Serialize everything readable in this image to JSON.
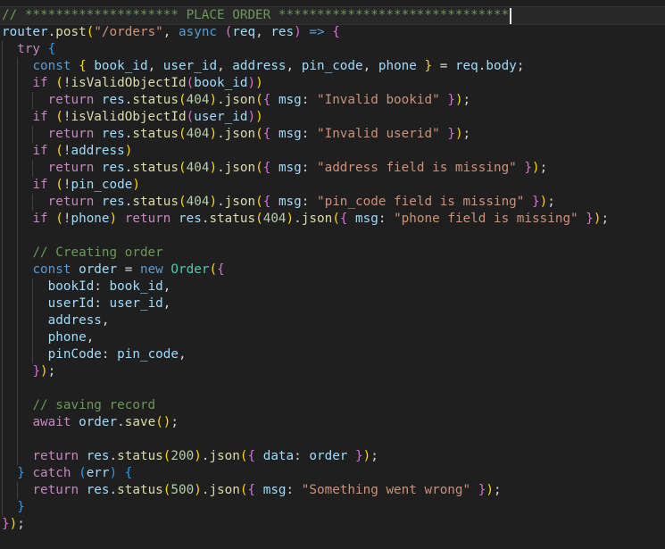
{
  "editor": {
    "language": "javascript",
    "colors": {
      "background": "#1f1f1f",
      "keyword": "#569cd6",
      "control": "#c586c0",
      "variable": "#9cdcfe",
      "function": "#dcdcaa",
      "string": "#ce9178",
      "number": "#b5cea8",
      "class": "#4ec9b0",
      "comment": "#6a9955",
      "bracket_1": "#ffd700",
      "bracket_2": "#da70d6",
      "bracket_3": "#179fff"
    },
    "lines": [
      [
        [
          "cmt",
          "// ******************** PLACE ORDER ******************************"
        ]
      ],
      [
        [
          "var",
          "router"
        ],
        [
          "pun",
          "."
        ],
        [
          "fn",
          "post"
        ],
        [
          "b1",
          "("
        ],
        [
          "str",
          "\"/orders\""
        ],
        [
          "pun",
          ", "
        ],
        [
          "kw",
          "async"
        ],
        [
          "pun",
          " "
        ],
        [
          "b2",
          "("
        ],
        [
          "var",
          "req"
        ],
        [
          "pun",
          ", "
        ],
        [
          "var",
          "res"
        ],
        [
          "b2",
          ")"
        ],
        [
          "pun",
          " "
        ],
        [
          "kw",
          "=>"
        ],
        [
          "pun",
          " "
        ],
        [
          "b2",
          "{"
        ]
      ],
      [
        [
          "pun",
          "  "
        ],
        [
          "ctl",
          "try"
        ],
        [
          "pun",
          " "
        ],
        [
          "b3",
          "{"
        ]
      ],
      [
        [
          "pun",
          "    "
        ],
        [
          "kw",
          "const"
        ],
        [
          "pun",
          " "
        ],
        [
          "b1",
          "{"
        ],
        [
          "pun",
          " "
        ],
        [
          "var",
          "book_id"
        ],
        [
          "pun",
          ", "
        ],
        [
          "var",
          "user_id"
        ],
        [
          "pun",
          ", "
        ],
        [
          "var",
          "address"
        ],
        [
          "pun",
          ", "
        ],
        [
          "var",
          "pin_code"
        ],
        [
          "pun",
          ", "
        ],
        [
          "var",
          "phone"
        ],
        [
          "pun",
          " "
        ],
        [
          "b1",
          "}"
        ],
        [
          "pun",
          " = "
        ],
        [
          "var",
          "req"
        ],
        [
          "pun",
          "."
        ],
        [
          "var",
          "body"
        ],
        [
          "pun",
          ";"
        ]
      ],
      [
        [
          "pun",
          "    "
        ],
        [
          "ctl",
          "if"
        ],
        [
          "pun",
          " "
        ],
        [
          "b1",
          "("
        ],
        [
          "pun",
          "!"
        ],
        [
          "fn",
          "isValidObjectId"
        ],
        [
          "b2",
          "("
        ],
        [
          "var",
          "book_id"
        ],
        [
          "b2",
          ")"
        ],
        [
          "b1",
          ")"
        ]
      ],
      [
        [
          "pun",
          "      "
        ],
        [
          "ctl",
          "return"
        ],
        [
          "pun",
          " "
        ],
        [
          "var",
          "res"
        ],
        [
          "pun",
          "."
        ],
        [
          "fn",
          "status"
        ],
        [
          "b1",
          "("
        ],
        [
          "num",
          "404"
        ],
        [
          "b1",
          ")"
        ],
        [
          "pun",
          "."
        ],
        [
          "fn",
          "json"
        ],
        [
          "b1",
          "("
        ],
        [
          "b2",
          "{"
        ],
        [
          "pun",
          " "
        ],
        [
          "var",
          "msg"
        ],
        [
          "pun",
          ": "
        ],
        [
          "str",
          "\"Invalid bookid\""
        ],
        [
          "pun",
          " "
        ],
        [
          "b2",
          "}"
        ],
        [
          "b1",
          ")"
        ],
        [
          "pun",
          ";"
        ]
      ],
      [
        [
          "pun",
          "    "
        ],
        [
          "ctl",
          "if"
        ],
        [
          "pun",
          " "
        ],
        [
          "b1",
          "("
        ],
        [
          "pun",
          "!"
        ],
        [
          "fn",
          "isValidObjectId"
        ],
        [
          "b2",
          "("
        ],
        [
          "var",
          "user_id"
        ],
        [
          "b2",
          ")"
        ],
        [
          "b1",
          ")"
        ]
      ],
      [
        [
          "pun",
          "      "
        ],
        [
          "ctl",
          "return"
        ],
        [
          "pun",
          " "
        ],
        [
          "var",
          "res"
        ],
        [
          "pun",
          "."
        ],
        [
          "fn",
          "status"
        ],
        [
          "b1",
          "("
        ],
        [
          "num",
          "404"
        ],
        [
          "b1",
          ")"
        ],
        [
          "pun",
          "."
        ],
        [
          "fn",
          "json"
        ],
        [
          "b1",
          "("
        ],
        [
          "b2",
          "{"
        ],
        [
          "pun",
          " "
        ],
        [
          "var",
          "msg"
        ],
        [
          "pun",
          ": "
        ],
        [
          "str",
          "\"Invalid userid\""
        ],
        [
          "pun",
          " "
        ],
        [
          "b2",
          "}"
        ],
        [
          "b1",
          ")"
        ],
        [
          "pun",
          ";"
        ]
      ],
      [
        [
          "pun",
          "    "
        ],
        [
          "ctl",
          "if"
        ],
        [
          "pun",
          " "
        ],
        [
          "b1",
          "("
        ],
        [
          "pun",
          "!"
        ],
        [
          "var",
          "address"
        ],
        [
          "b1",
          ")"
        ]
      ],
      [
        [
          "pun",
          "      "
        ],
        [
          "ctl",
          "return"
        ],
        [
          "pun",
          " "
        ],
        [
          "var",
          "res"
        ],
        [
          "pun",
          "."
        ],
        [
          "fn",
          "status"
        ],
        [
          "b1",
          "("
        ],
        [
          "num",
          "404"
        ],
        [
          "b1",
          ")"
        ],
        [
          "pun",
          "."
        ],
        [
          "fn",
          "json"
        ],
        [
          "b1",
          "("
        ],
        [
          "b2",
          "{"
        ],
        [
          "pun",
          " "
        ],
        [
          "var",
          "msg"
        ],
        [
          "pun",
          ": "
        ],
        [
          "str",
          "\"address field is missing\""
        ],
        [
          "pun",
          " "
        ],
        [
          "b2",
          "}"
        ],
        [
          "b1",
          ")"
        ],
        [
          "pun",
          ";"
        ]
      ],
      [
        [
          "pun",
          "    "
        ],
        [
          "ctl",
          "if"
        ],
        [
          "pun",
          " "
        ],
        [
          "b1",
          "("
        ],
        [
          "pun",
          "!"
        ],
        [
          "var",
          "pin_code"
        ],
        [
          "b1",
          ")"
        ]
      ],
      [
        [
          "pun",
          "      "
        ],
        [
          "ctl",
          "return"
        ],
        [
          "pun",
          " "
        ],
        [
          "var",
          "res"
        ],
        [
          "pun",
          "."
        ],
        [
          "fn",
          "status"
        ],
        [
          "b1",
          "("
        ],
        [
          "num",
          "404"
        ],
        [
          "b1",
          ")"
        ],
        [
          "pun",
          "."
        ],
        [
          "fn",
          "json"
        ],
        [
          "b1",
          "("
        ],
        [
          "b2",
          "{"
        ],
        [
          "pun",
          " "
        ],
        [
          "var",
          "msg"
        ],
        [
          "pun",
          ": "
        ],
        [
          "str",
          "\"pin_code field is missing\""
        ],
        [
          "pun",
          " "
        ],
        [
          "b2",
          "}"
        ],
        [
          "b1",
          ")"
        ],
        [
          "pun",
          ";"
        ]
      ],
      [
        [
          "pun",
          "    "
        ],
        [
          "ctl",
          "if"
        ],
        [
          "pun",
          " "
        ],
        [
          "b1",
          "("
        ],
        [
          "pun",
          "!"
        ],
        [
          "var",
          "phone"
        ],
        [
          "b1",
          ")"
        ],
        [
          "pun",
          " "
        ],
        [
          "ctl",
          "return"
        ],
        [
          "pun",
          " "
        ],
        [
          "var",
          "res"
        ],
        [
          "pun",
          "."
        ],
        [
          "fn",
          "status"
        ],
        [
          "b1",
          "("
        ],
        [
          "num",
          "404"
        ],
        [
          "b1",
          ")"
        ],
        [
          "pun",
          "."
        ],
        [
          "fn",
          "json"
        ],
        [
          "b1",
          "("
        ],
        [
          "b2",
          "{"
        ],
        [
          "pun",
          " "
        ],
        [
          "var",
          "msg"
        ],
        [
          "pun",
          ": "
        ],
        [
          "str",
          "\"phone field is missing\""
        ],
        [
          "pun",
          " "
        ],
        [
          "b2",
          "}"
        ],
        [
          "b1",
          ")"
        ],
        [
          "pun",
          ";"
        ]
      ],
      [],
      [
        [
          "pun",
          "    "
        ],
        [
          "cmt",
          "// Creating order"
        ]
      ],
      [
        [
          "pun",
          "    "
        ],
        [
          "kw",
          "const"
        ],
        [
          "pun",
          " "
        ],
        [
          "var",
          "order"
        ],
        [
          "pun",
          " = "
        ],
        [
          "kw",
          "new"
        ],
        [
          "pun",
          " "
        ],
        [
          "cls",
          "Order"
        ],
        [
          "b1",
          "("
        ],
        [
          "b2",
          "{"
        ]
      ],
      [
        [
          "pun",
          "      "
        ],
        [
          "var",
          "bookId"
        ],
        [
          "pun",
          ": "
        ],
        [
          "var",
          "book_id"
        ],
        [
          "pun",
          ","
        ]
      ],
      [
        [
          "pun",
          "      "
        ],
        [
          "var",
          "userId"
        ],
        [
          "pun",
          ": "
        ],
        [
          "var",
          "user_id"
        ],
        [
          "pun",
          ","
        ]
      ],
      [
        [
          "pun",
          "      "
        ],
        [
          "var",
          "address"
        ],
        [
          "pun",
          ","
        ]
      ],
      [
        [
          "pun",
          "      "
        ],
        [
          "var",
          "phone"
        ],
        [
          "pun",
          ","
        ]
      ],
      [
        [
          "pun",
          "      "
        ],
        [
          "var",
          "pinCode"
        ],
        [
          "pun",
          ": "
        ],
        [
          "var",
          "pin_code"
        ],
        [
          "pun",
          ","
        ]
      ],
      [
        [
          "pun",
          "    "
        ],
        [
          "b2",
          "}"
        ],
        [
          "b1",
          ")"
        ],
        [
          "pun",
          ";"
        ]
      ],
      [],
      [
        [
          "pun",
          "    "
        ],
        [
          "cmt",
          "// saving record"
        ]
      ],
      [
        [
          "pun",
          "    "
        ],
        [
          "ctl",
          "await"
        ],
        [
          "pun",
          " "
        ],
        [
          "var",
          "order"
        ],
        [
          "pun",
          "."
        ],
        [
          "fn",
          "save"
        ],
        [
          "b1",
          "("
        ],
        [
          "b1",
          ")"
        ],
        [
          "pun",
          ";"
        ]
      ],
      [],
      [
        [
          "pun",
          "    "
        ],
        [
          "ctl",
          "return"
        ],
        [
          "pun",
          " "
        ],
        [
          "var",
          "res"
        ],
        [
          "pun",
          "."
        ],
        [
          "fn",
          "status"
        ],
        [
          "b1",
          "("
        ],
        [
          "num",
          "200"
        ],
        [
          "b1",
          ")"
        ],
        [
          "pun",
          "."
        ],
        [
          "fn",
          "json"
        ],
        [
          "b1",
          "("
        ],
        [
          "b2",
          "{"
        ],
        [
          "pun",
          " "
        ],
        [
          "var",
          "data"
        ],
        [
          "pun",
          ": "
        ],
        [
          "var",
          "order"
        ],
        [
          "pun",
          " "
        ],
        [
          "b2",
          "}"
        ],
        [
          "b1",
          ")"
        ],
        [
          "pun",
          ";"
        ]
      ],
      [
        [
          "pun",
          "  "
        ],
        [
          "b3",
          "}"
        ],
        [
          "pun",
          " "
        ],
        [
          "ctl",
          "catch"
        ],
        [
          "pun",
          " "
        ],
        [
          "b3",
          "("
        ],
        [
          "var",
          "err"
        ],
        [
          "b3",
          ")"
        ],
        [
          "pun",
          " "
        ],
        [
          "b3",
          "{"
        ]
      ],
      [
        [
          "pun",
          "    "
        ],
        [
          "ctl",
          "return"
        ],
        [
          "pun",
          " "
        ],
        [
          "var",
          "res"
        ],
        [
          "pun",
          "."
        ],
        [
          "fn",
          "status"
        ],
        [
          "b1",
          "("
        ],
        [
          "num",
          "500"
        ],
        [
          "b1",
          ")"
        ],
        [
          "pun",
          "."
        ],
        [
          "fn",
          "json"
        ],
        [
          "b1",
          "("
        ],
        [
          "b2",
          "{"
        ],
        [
          "pun",
          " "
        ],
        [
          "var",
          "msg"
        ],
        [
          "pun",
          ": "
        ],
        [
          "str",
          "\"Something went wrong\""
        ],
        [
          "pun",
          " "
        ],
        [
          "b2",
          "}"
        ],
        [
          "b1",
          ")"
        ],
        [
          "pun",
          ";"
        ]
      ],
      [
        [
          "pun",
          "  "
        ],
        [
          "b3",
          "}"
        ]
      ],
      [
        [
          "b2",
          "}"
        ],
        [
          "b1",
          ")"
        ],
        [
          "pun",
          ";"
        ]
      ]
    ]
  }
}
